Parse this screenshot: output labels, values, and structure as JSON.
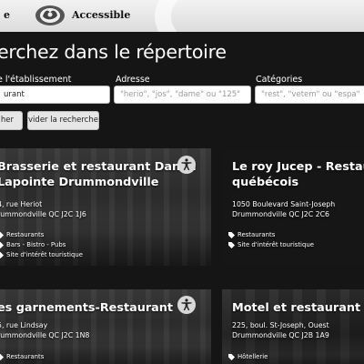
{
  "header": {
    "brand_left": "e",
    "brand_right": "Accessible",
    "logo_icon": "rose-logo-icon"
  },
  "search": {
    "title": "erchez dans le répertoire",
    "name_label": "e l'établissement",
    "name_value": "urant",
    "address_label": "Adresse",
    "address_placeholder": "\"herio\", \"jos\", \"dame\" ou \"125\"",
    "categories_label": "Catégories",
    "categories_placeholder": "\"rest\", \"vetem\" ou \"espa\"",
    "search_button": "her",
    "clear_button": "vider la recherche"
  },
  "results": [
    {
      "title_lines": [
        "Brasserie et restaurant Daniel",
        "Lapointe Drummondville"
      ],
      "address_lines": [
        "4, rue Heriot",
        "rummondville QC J2C 1J6"
      ],
      "tags": [
        "Restaurants",
        "Bars - Bistro - Pubs",
        "Site d'intérêt touristique"
      ],
      "accessible_icon": "accessibility-icon"
    },
    {
      "title_lines": [
        "Le roy Jucep - Restaura",
        "québécois"
      ],
      "address_lines": [
        "1050 Boulevard Saint-Joseph",
        "Drummondville QC J2C 2C6"
      ],
      "tags": [
        "Restaurants",
        "Site d'intérêt touristique"
      ]
    },
    {
      "title_lines": [
        "es garnements-Restaurant"
      ],
      "address_lines": [
        "5, rue Lindsay",
        "rummondville QC J2C 1N8"
      ],
      "tags": [
        "Restaurants"
      ],
      "accessible_icon": "accessibility-icon"
    },
    {
      "title_lines": [
        "Motel et restaurant Blan"
      ],
      "address_lines": [
        "225, boul. St-Joseph, Ouest",
        "Drummondville QC J2B 1A9"
      ],
      "tags": [
        "Hôtellerie"
      ]
    }
  ],
  "colors": {
    "background": "#151515",
    "header_bg": "#e8e8e8",
    "text": "#ffffff",
    "button_bg": "#e6e6e6"
  }
}
